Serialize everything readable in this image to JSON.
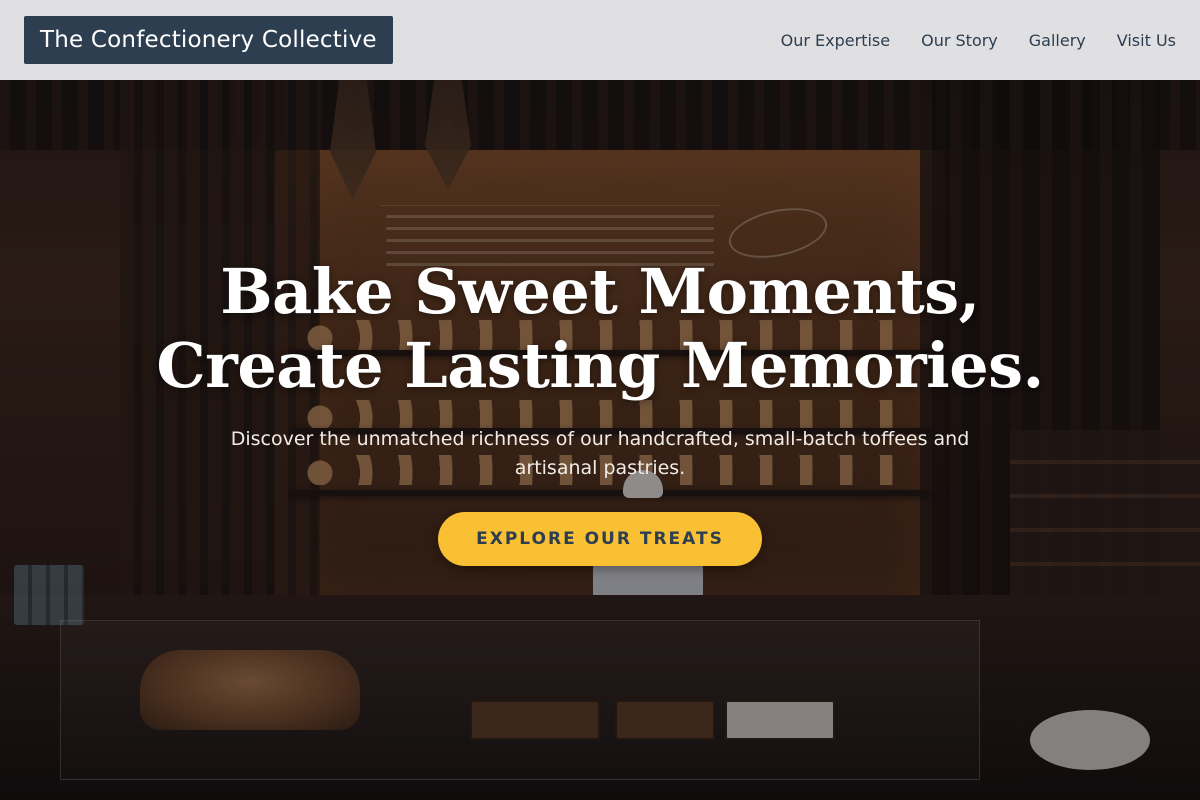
{
  "header": {
    "brand": "The Confectionery Collective",
    "nav": [
      {
        "label": "Our Expertise"
      },
      {
        "label": "Our Story"
      },
      {
        "label": "Gallery"
      },
      {
        "label": "Visit Us"
      }
    ]
  },
  "hero": {
    "title_line1": "Bake Sweet Moments,",
    "title_line2": "Create Lasting Memories.",
    "subtitle": "Discover the unmatched richness of our handcrafted, small-batch toffees and artisanal pastries.",
    "cta_label": "EXPLORE OUR TREATS",
    "background_image": "bakery-interior"
  },
  "colors": {
    "brand_bg": "#2c3e50",
    "header_bg": "#e8e8ea",
    "cta_bg": "#f9c033",
    "cta_text": "#2c3e50",
    "nav_text": "#2c3e50"
  }
}
